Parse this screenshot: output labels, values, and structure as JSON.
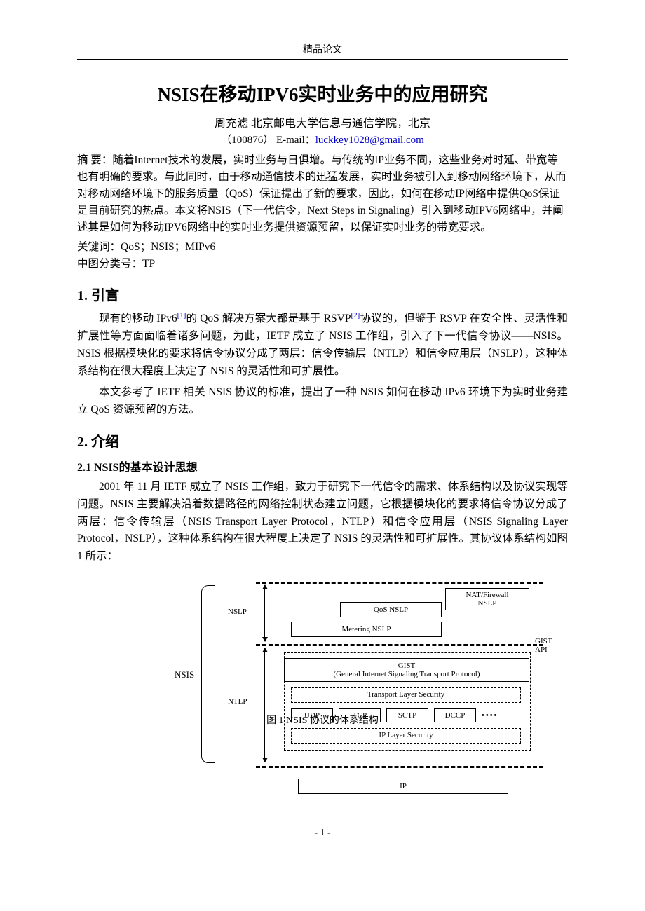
{
  "header": {
    "label": "精品论文"
  },
  "doc": {
    "title": "NSIS在移动IPV6实时业务中的应用研究",
    "authors_line": "周充滤  北京邮电大学信息与通信学院，北京",
    "affil_prefix": "（100876）  E-mail：",
    "email": "luckkey1028@gmail.com",
    "abstract_label": "摘    要：",
    "abstract_body": "随着Internet技术的发展，实时业务与日俱增。与传统的IP业务不同，这些业务对时延、带宽等也有明确的要求。与此同时，由于移动通信技术的迅猛发展，实时业务被引入到移动网络环境下，从而对移动网络环境下的服务质量（QoS）保证提出了新的要求，因此，如何在移动IP网络中提供QoS保证是目前研究的热点。本文将NSIS（下一代信令，Next Steps in Signaling）引入到移动IPV6网络中，并阐述其是如何为移动IPV6网络中的实时业务提供资源预留，以保证实时业务的带宽要求。",
    "keywords_label": "关键词：",
    "keywords_body": "QoS；NSIS；MIPv6",
    "clc_label": "中图分类号：",
    "clc_body": "TP"
  },
  "sections": {
    "s1_title": "1.  引言",
    "s1_p1_a": "现有的移动 IPv6",
    "s1_ref1": "[1]",
    "s1_p1_b": "的 QoS 解决方案大都是基于 RSVP",
    "s1_ref2": "[2]",
    "s1_p1_c": "协议的，但鉴于 RSVP 在安全性、灵活性和扩展性等方面面临着诸多问题，为此，IETF 成立了 NSIS 工作组，引入了下一代信令协议——NSIS。NSIS 根据模块化的要求将信令协议分成了两层：信令传输层（NTLP）和信令应用层（NSLP），这种体系结构在很大程度上决定了 NSIS 的灵活性和可扩展性。",
    "s1_p2": "本文参考了 IETF 相关 NSIS 协议的标准，提出了一种 NSIS 如何在移动 IPv6 环境下为实时业务建立 QoS 资源预留的方法。",
    "s2_title": "2.  介绍",
    "s2_1_title": "2.1  NSIS的基本设计思想",
    "s2_1_p1": "2001 年 11 月 IETF 成立了 NSIS 工作组，致力于研究下一代信令的需求、体系结构以及协议实现等问题。NSIS 主要解决沿着数据路径的网络控制状态建立问题，它根据模块化的要求将信令协议分成了两层：信令传输层（NSIS Transport Layer Protocol，NTLP）和信令应用层（NSIS Signaling Layer Protocol，NSLP），这种体系结构在很大程度上决定了 NSIS 的灵活性和可扩展性。其协议体系结构如图 1 所示："
  },
  "figure": {
    "caption": "图 1 NSIS 协议的体系结构",
    "labels": {
      "nslp": "NSLP",
      "ntlp": "NTLP",
      "nsis": "NSIS",
      "gist_api": "GIST\nAPI"
    },
    "boxes": {
      "nat": "NAT/Firewall\nNSLP",
      "qos": "QoS NSLP",
      "metering": "Metering NSLP",
      "gist": "GIST\n(General Internet Signaling Transport Protocol)",
      "tls": "Transport Layer Security",
      "ils": "IP Layer Security",
      "ip": "IP"
    },
    "protocols": [
      "UDP",
      "TCP",
      "SCTP",
      "DCCP"
    ],
    "dots": "••••"
  },
  "footer": {
    "page": "- 1 -"
  }
}
